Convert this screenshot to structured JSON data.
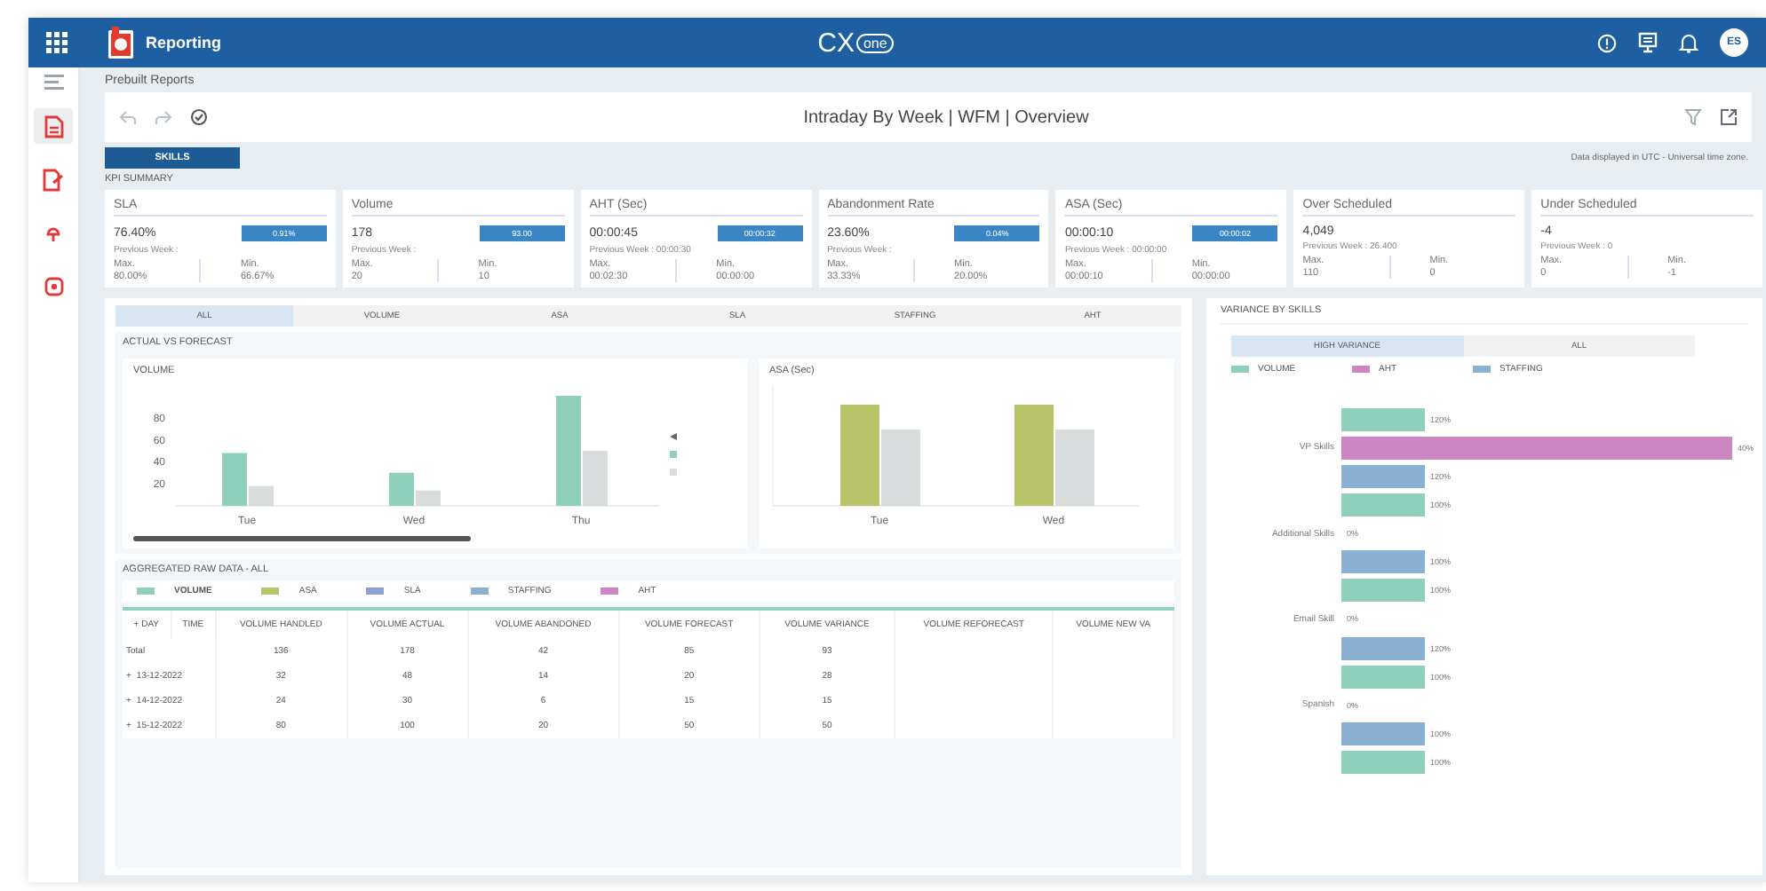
{
  "topbar": {
    "app_title": "Reporting",
    "logo_cx": "CX",
    "logo_one": "one",
    "avatar": "ES"
  },
  "sidebar": {
    "items": [
      {
        "selected": true
      },
      {
        "selected": false
      },
      {
        "selected": false
      },
      {
        "selected": false
      }
    ]
  },
  "breadcrumb": "Prebuilt Reports",
  "report_title": "Intraday By Week | WFM | Overview",
  "view_tabs": [
    {
      "label": "SKILLS",
      "selected": true
    }
  ],
  "timezone_note": "Data displayed in UTC - Universal time zone.",
  "kpi_summary": {
    "title": "KPI SUMMARY",
    "cards": [
      {
        "title": "SLA",
        "value": "76.40%",
        "badge": "0.91%",
        "previous": "Previous Week :",
        "max_label": "Max.",
        "max": "80.00%",
        "min_label": "Min.",
        "min": "66.67%"
      },
      {
        "title": "Volume",
        "value": "178",
        "badge": "93.00",
        "previous": "Previous Week :",
        "max_label": "Max.",
        "max": "20",
        "min_label": "Min.",
        "min": "10"
      },
      {
        "title": "AHT (Sec)",
        "value": "00:00:45",
        "badge": "00:00:32",
        "previous": "Previous Week : 00:00:30",
        "max_label": "Max.",
        "max": "00:02:30",
        "min_label": "Min.",
        "min": "00:00:00"
      },
      {
        "title": "Abandonment Rate",
        "value": "23.60%",
        "badge": "0.04%",
        "previous": "Previous Week :",
        "max_label": "Max.",
        "max": "33.33%",
        "min_label": "Min.",
        "min": "20.00%"
      },
      {
        "title": "ASA (Sec)",
        "value": "00:00:10",
        "badge": "00:00:02",
        "previous": "Previous Week : 00:00:00",
        "max_label": "Max.",
        "max": "00:00:10",
        "min_label": "Min.",
        "min": "00:00:00"
      },
      {
        "title": "Over Scheduled",
        "value": "4,049",
        "previous": "Previous Week : 26.400",
        "max_label": "Max.",
        "max": "110",
        "min_label": "Min.",
        "min": "0"
      },
      {
        "title": "Under Scheduled",
        "value": "-4",
        "previous": "Previous Week : 0",
        "max_label": "Max.",
        "max": "0",
        "min_label": "Min.",
        "min": "-1"
      }
    ]
  },
  "metric_tabs": [
    {
      "label": "ALL",
      "selected": true
    },
    {
      "label": "VOLUME",
      "selected": false
    },
    {
      "label": "ASA",
      "selected": false
    },
    {
      "label": "SLA",
      "selected": false
    },
    {
      "label": "STAFFING",
      "selected": false
    },
    {
      "label": "AHT",
      "selected": false
    }
  ],
  "actual_vs_forecast": {
    "title": "ACTUAL VS FORECAST",
    "volume_chart": {
      "chart_data": {
        "type": "bar",
        "title": "VOLUME",
        "categories": [
          "Tue",
          "Wed",
          "Thu"
        ],
        "series": [
          {
            "color": "#8fd0bc",
            "values": [
              48,
              30,
              100
            ]
          },
          {
            "color": "#d9dcdc",
            "values": [
              18,
              14,
              50
            ]
          }
        ],
        "ylim": [
          0,
          100
        ],
        "yticks": [
          20,
          40,
          60,
          80
        ]
      }
    },
    "asa_chart": {
      "title": "ASA (Sec)",
      "x_labels": [
        "Tue",
        "Wed"
      ]
    }
  },
  "raw_data": {
    "title": "AGGREGATED RAW DATA - ALL",
    "legend": [
      {
        "label": "VOLUME",
        "color": "#8fd0bc",
        "selected": true
      },
      {
        "label": "ASA",
        "color": "#b8c46a",
        "selected": false
      },
      {
        "label": "SLA",
        "color": "#8e9ed6",
        "selected": false
      },
      {
        "label": "STAFFING",
        "color": "#8ab0d2",
        "selected": false
      },
      {
        "label": "AHT",
        "color": "#cc86c2",
        "selected": false
      }
    ],
    "row_header_columns": [
      "+ DAY",
      "TIME"
    ],
    "columns": [
      "VOLUME HANDLED",
      "VOLUME ACTUAL",
      "VOLUME ABANDONED",
      "VOLUME FORECAST",
      "VOLUME VARIANCE",
      "VOLUME REFORECAST",
      "VOLUME NEW VA"
    ],
    "rows": [
      {
        "label": "Total",
        "cells": [
          "136",
          "178",
          "42",
          "85",
          "93"
        ]
      },
      {
        "expander": "+",
        "label": "13-12-2022",
        "cells": [
          "32",
          "48",
          "14",
          "20",
          "28"
        ]
      },
      {
        "expander": "+",
        "label": "14-12-2022",
        "cells": [
          "24",
          "30",
          "6",
          "15",
          "15"
        ]
      },
      {
        "expander": "+",
        "label": "15-12-2022",
        "cells": [
          "80",
          "100",
          "20",
          "50",
          "50"
        ]
      }
    ]
  },
  "variance": {
    "title": "VARIANCE BY SKILLS",
    "tabs": [
      {
        "label": "HIGH VARIANCE",
        "selected": true
      },
      {
        "label": "ALL",
        "selected": false
      }
    ],
    "legend": [
      {
        "label": "VOLUME",
        "color": "#8fd0bc"
      },
      {
        "label": "AHT",
        "color": "#cc86c2"
      },
      {
        "label": "STAFFING",
        "color": "#8ab0d2"
      }
    ],
    "rows": [
      {
        "kind": "bar",
        "color": "#8fd0bc",
        "value": "120%"
      },
      {
        "kind": "long_bar",
        "skill": "VP Skills",
        "color": "#cc86c2",
        "value": "40%"
      },
      {
        "kind": "bar",
        "color": "#8ab0d2",
        "value": "120%"
      },
      {
        "kind": "bar",
        "color": "#8fd0bc",
        "value": "100%"
      },
      {
        "kind": "skill",
        "skill": "Additional Skills",
        "value": "0%"
      },
      {
        "kind": "bar",
        "color": "#8ab0d2",
        "value": "100%"
      },
      {
        "kind": "bar",
        "color": "#8fd0bc",
        "value": "100%"
      },
      {
        "kind": "skill",
        "skill": "Email Skill",
        "value": "0%"
      },
      {
        "kind": "bar",
        "color": "#8ab0d2",
        "value": "120%"
      },
      {
        "kind": "bar",
        "color": "#8fd0bc",
        "value": "100%"
      },
      {
        "kind": "skill",
        "skill": "Spanish",
        "value": "0%"
      },
      {
        "kind": "bar",
        "color": "#8ab0d2",
        "value": "100%"
      },
      {
        "kind": "bar",
        "color": "#8fd0bc",
        "value": "100%"
      }
    ]
  }
}
